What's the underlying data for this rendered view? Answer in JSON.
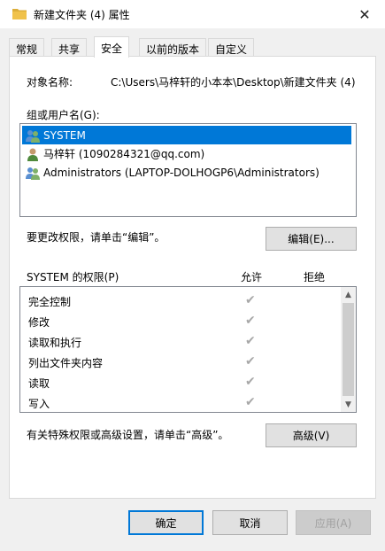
{
  "window": {
    "title": "新建文件夹 (4) 属性",
    "close_glyph": "✕"
  },
  "tabs": [
    {
      "label": "常规"
    },
    {
      "label": "共享"
    },
    {
      "label": "安全",
      "active": true
    },
    {
      "label": "以前的版本"
    },
    {
      "label": "自定义"
    }
  ],
  "object": {
    "label": "对象名称:",
    "value": "C:\\Users\\马梓轩的小本本\\Desktop\\新建文件夹 (4)"
  },
  "groups": {
    "label": "组或用户名(G):",
    "items": [
      {
        "name": "SYSTEM",
        "icon": "group-users-icon",
        "selected": true
      },
      {
        "name": "马梓轩 (1090284321@qq.com)",
        "icon": "user-icon"
      },
      {
        "name": "Administrators (LAPTOP-DOLHOGP6\\Administrators)",
        "icon": "group-users-icon"
      }
    ]
  },
  "edit": {
    "hint": "要更改权限，请单击“编辑”。",
    "button": "编辑(E)..."
  },
  "permissions": {
    "title": "SYSTEM 的权限(P)",
    "allow_header": "允许",
    "deny_header": "拒绝",
    "allow_glyph": "✔",
    "rows": [
      {
        "name": "完全控制",
        "allow": true,
        "deny": false
      },
      {
        "name": "修改",
        "allow": true,
        "deny": false
      },
      {
        "name": "读取和执行",
        "allow": true,
        "deny": false
      },
      {
        "name": "列出文件夹内容",
        "allow": true,
        "deny": false
      },
      {
        "name": "读取",
        "allow": true,
        "deny": false
      },
      {
        "name": "写入",
        "allow": true,
        "deny": false
      }
    ]
  },
  "advanced": {
    "hint": "有关特殊权限或高级设置，请单击“高级”。",
    "button": "高级(V)"
  },
  "footer": {
    "ok": "确定",
    "cancel": "取消",
    "apply": "应用(A)"
  },
  "colors": {
    "accent": "#0078d7",
    "folder": "#f0c24b",
    "check": "#a8a8a8"
  }
}
